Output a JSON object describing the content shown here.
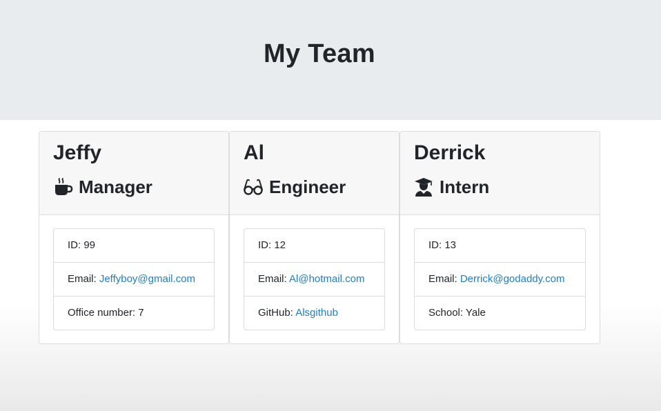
{
  "header": {
    "title": "My Team"
  },
  "colors": {
    "link": "#1f7fc4",
    "jumbotron_bg": "#e9ecef",
    "card_header_bg": "#f7f7f7"
  },
  "employees": [
    {
      "name": "Jeffy",
      "role": "Manager",
      "icon": "coffee-icon",
      "id_label": "ID: 99",
      "email_prefix": "Email: ",
      "email": "Jeffyboy@gmail.com",
      "extra_prefix": "Office number: 7",
      "extra_link": ""
    },
    {
      "name": "Al",
      "role": "Engineer",
      "icon": "glasses-icon",
      "id_label": "ID: 12",
      "email_prefix": "Email: ",
      "email": "Al@hotmail.com",
      "extra_prefix": "GitHub: ",
      "extra_link": "Alsgithub"
    },
    {
      "name": "Derrick",
      "role": "Intern",
      "icon": "graduate-icon",
      "id_label": "ID: 13",
      "email_prefix": "Email: ",
      "email": "Derrick@godaddy.com",
      "extra_prefix": "School: Yale",
      "extra_link": ""
    }
  ]
}
